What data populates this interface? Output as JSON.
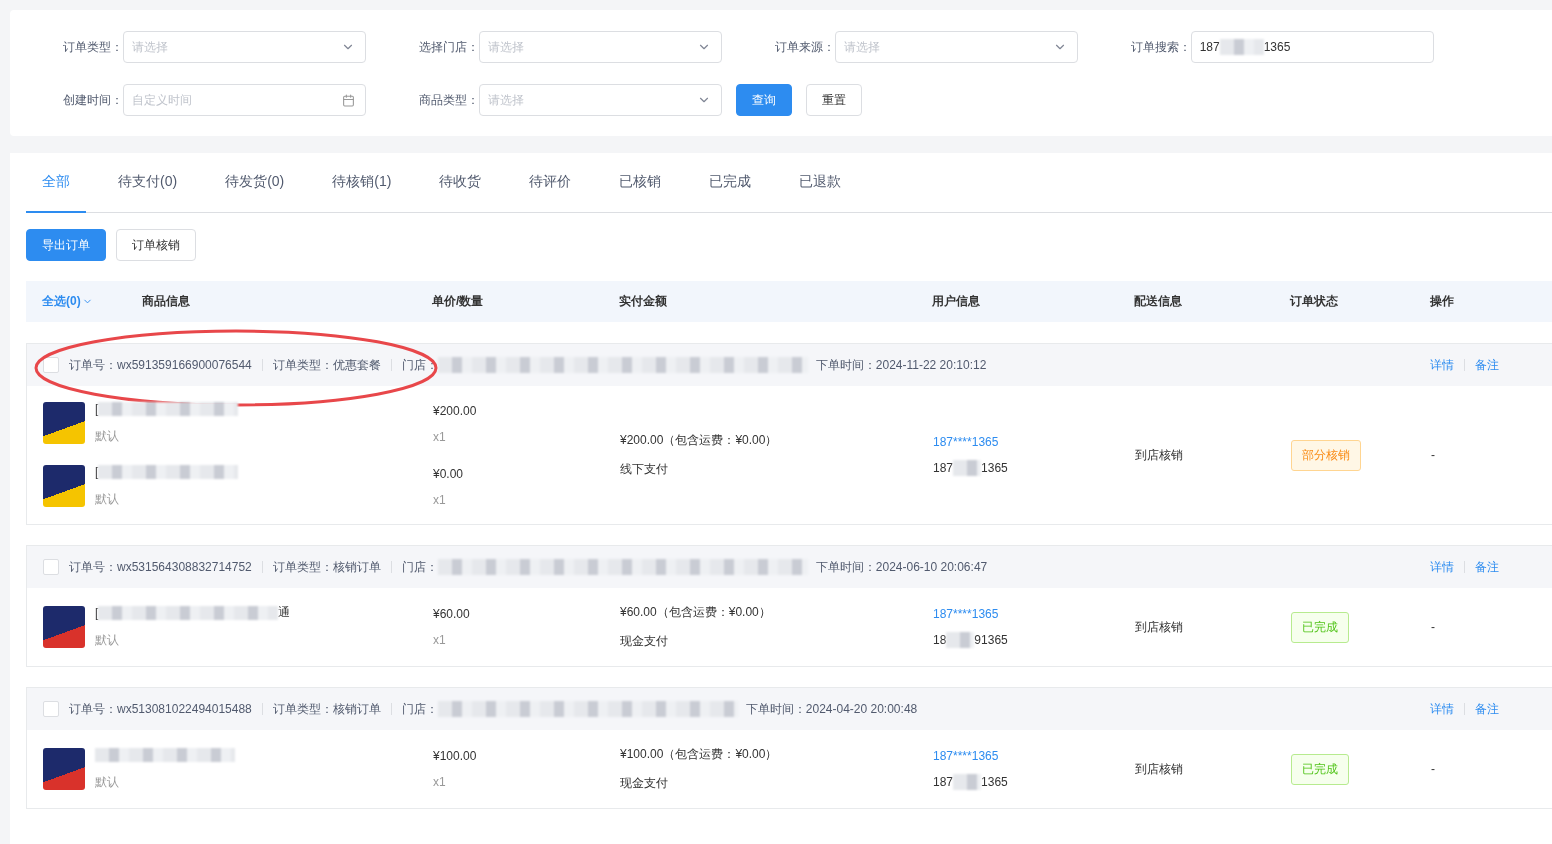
{
  "filters": [
    {
      "label": "订单类型：",
      "kind": "select",
      "placeholder": "请选择"
    },
    {
      "label": "选择门店：",
      "kind": "select",
      "placeholder": "请选择"
    },
    {
      "label": "订单来源：",
      "kind": "select",
      "placeholder": "请选择"
    },
    {
      "label": "订单搜索：",
      "kind": "search",
      "value_start": "187",
      "value_end": "1365"
    },
    {
      "label": "创建时间：",
      "kind": "date",
      "placeholder": "自定义时间"
    },
    {
      "label": "商品类型：",
      "kind": "select",
      "placeholder": "请选择"
    }
  ],
  "filter_buttons": [
    {
      "label": "查询",
      "primary": true
    },
    {
      "label": "重置",
      "primary": false
    }
  ],
  "tabs": [
    {
      "label": "全部",
      "selected": true
    },
    {
      "label": "待支付(0)",
      "selected": false
    },
    {
      "label": "待发货(0)",
      "selected": false
    },
    {
      "label": "待核销(1)",
      "selected": false
    },
    {
      "label": "待收货",
      "selected": false
    },
    {
      "label": "待评价",
      "selected": false
    },
    {
      "label": "已核销",
      "selected": false
    },
    {
      "label": "已完成",
      "selected": false
    },
    {
      "label": "已退款",
      "selected": false
    }
  ],
  "actions": [
    {
      "label": "导出订单",
      "primary": true
    },
    {
      "label": "订单核销",
      "primary": false
    }
  ],
  "table": {
    "select_all": "全选(0)",
    "columns": [
      "商品信息",
      "单价/数量",
      "实付金额",
      "用户信息",
      "配送信息",
      "订单状态",
      "操作"
    ]
  },
  "orders": [
    {
      "order_no": "订单号：wx591359166900076544",
      "order_type": "订单类型：优惠套餐",
      "store_label": "门店：",
      "time": "下单时间：2024-11-22 20:10:12",
      "links": [
        "详情",
        "备注"
      ],
      "circled": true,
      "checked": false,
      "items": [
        {
          "name_start": "[",
          "spec": "默认",
          "price": "¥200.00",
          "qty": "x1"
        },
        {
          "name_start": "[",
          "spec": "默认",
          "price": "¥0.00",
          "qty": "x1"
        }
      ],
      "paid": "¥200.00（包含运费：¥0.00）",
      "pay_method": "线下支付",
      "user_masked": "187****1365",
      "phone_start": "187",
      "phone_end": "1365",
      "delivery": "到店核销",
      "status": {
        "label": "部分核销",
        "kind": "partial"
      },
      "action": "-"
    },
    {
      "order_no": "订单号：wx531564308832714752",
      "order_type": "订单类型：核销订单",
      "store_label": "门店：",
      "time": "下单时间：2024-06-10 20:06:47",
      "links": [
        "详情",
        "备注"
      ],
      "circled": false,
      "checked": false,
      "items": [
        {
          "name_start": "[",
          "name_end": "通",
          "spec": "默认",
          "price": "¥60.00",
          "qty": "x1"
        }
      ],
      "paid": "¥60.00（包含运费：¥0.00）",
      "pay_method": "现金支付",
      "user_masked": "187****1365",
      "phone_start": "18",
      "phone_end": "91365",
      "delivery": "到店核销",
      "status": {
        "label": "已完成",
        "kind": "done"
      },
      "action": "-"
    },
    {
      "order_no": "订单号：wx513081022494015488",
      "order_type": "订单类型：核销订单",
      "store_label": "门店：",
      "time": "下单时间：2024-04-20 20:00:48",
      "links": [
        "详情",
        "备注"
      ],
      "circled": false,
      "checked": false,
      "items": [
        {
          "spec": "默认",
          "price": "¥100.00",
          "qty": "x1"
        }
      ],
      "paid": "¥100.00（包含运费：¥0.00）",
      "pay_method": "现金支付",
      "user_masked": "187****1365",
      "phone_start": "187",
      "phone_end": "1365",
      "delivery": "到店核销",
      "status": {
        "label": "已完成",
        "kind": "done"
      },
      "action": "-"
    }
  ]
}
